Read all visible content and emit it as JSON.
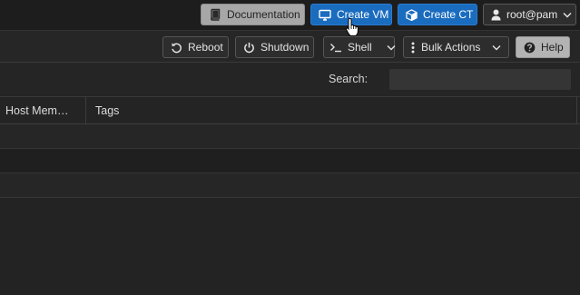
{
  "header": {
    "documentation_label": "Documentation",
    "create_vm_label": "Create VM",
    "create_ct_label": "Create CT",
    "user_label": "root@pam"
  },
  "toolbar": {
    "reboot_label": "Reboot",
    "shutdown_label": "Shutdown",
    "shell_label": "Shell",
    "bulk_actions_label": "Bulk Actions",
    "help_label": "Help"
  },
  "search": {
    "label": "Search:",
    "value": ""
  },
  "grid": {
    "columns": [
      "Host Mem…",
      "Tags"
    ],
    "rows": [
      {
        "host_mem": "",
        "tags": ""
      },
      {
        "host_mem": "",
        "tags": ""
      },
      {
        "host_mem": "",
        "tags": ""
      }
    ]
  },
  "icons": {
    "documentation": "book-icon",
    "create_vm": "monitor-icon",
    "create_ct": "cube-icon",
    "user": "user-icon",
    "reboot": "reboot-icon",
    "shutdown": "power-icon",
    "shell": "terminal-icon",
    "bulk_actions": "vertical-ellipsis-icon",
    "help": "question-circle-icon"
  },
  "colors": {
    "primary_blue": "#1a6cbf",
    "background": "#232323"
  }
}
